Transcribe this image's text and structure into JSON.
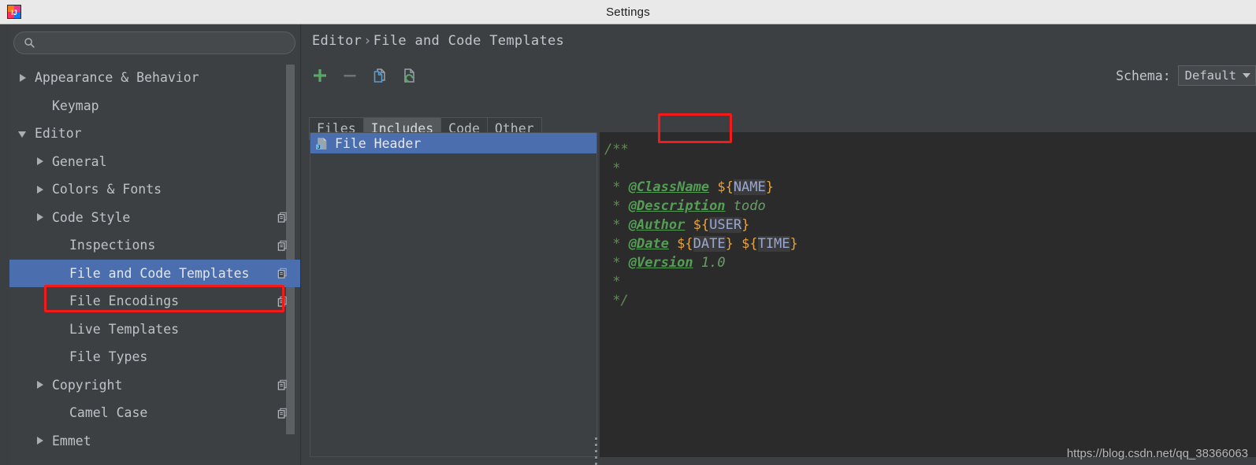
{
  "window": {
    "title": "Settings",
    "app_icon": "intellij-idea-icon"
  },
  "sidebar": {
    "search": {
      "value": "",
      "placeholder": "",
      "icon": "search-icon"
    },
    "items": [
      {
        "label": "Appearance & Behavior",
        "indent": 0,
        "arrow": "closed",
        "selected": false,
        "copy_icon": false
      },
      {
        "label": "Keymap",
        "indent": 1,
        "arrow": "none",
        "selected": false,
        "copy_icon": false
      },
      {
        "label": "Editor",
        "indent": 0,
        "arrow": "open",
        "selected": false,
        "copy_icon": false
      },
      {
        "label": "General",
        "indent": 1,
        "arrow": "closed",
        "selected": false,
        "copy_icon": false
      },
      {
        "label": "Colors & Fonts",
        "indent": 1,
        "arrow": "closed",
        "selected": false,
        "copy_icon": false
      },
      {
        "label": "Code Style",
        "indent": 1,
        "arrow": "closed",
        "selected": false,
        "copy_icon": true
      },
      {
        "label": "Inspections",
        "indent": 2,
        "arrow": "none",
        "selected": false,
        "copy_icon": true
      },
      {
        "label": "File and Code Templates",
        "indent": 2,
        "arrow": "none",
        "selected": true,
        "copy_icon": true
      },
      {
        "label": "File Encodings",
        "indent": 2,
        "arrow": "none",
        "selected": false,
        "copy_icon": true
      },
      {
        "label": "Live Templates",
        "indent": 2,
        "arrow": "none",
        "selected": false,
        "copy_icon": false
      },
      {
        "label": "File Types",
        "indent": 2,
        "arrow": "none",
        "selected": false,
        "copy_icon": false
      },
      {
        "label": "Copyright",
        "indent": 1,
        "arrow": "closed",
        "selected": false,
        "copy_icon": true
      },
      {
        "label": "Camel Case",
        "indent": 2,
        "arrow": "none",
        "selected": false,
        "copy_icon": true
      },
      {
        "label": "Emmet",
        "indent": 1,
        "arrow": "closed",
        "selected": false,
        "copy_icon": false
      }
    ]
  },
  "content": {
    "breadcrumb": {
      "root": "Editor",
      "separator": "›",
      "leaf": "File and Code Templates"
    },
    "toolbar": [
      {
        "name": "add-template-button",
        "icon": "plus-icon"
      },
      {
        "name": "remove-template-button",
        "icon": "minus-icon"
      },
      {
        "name": "copy-template-button",
        "icon": "copy-icon"
      },
      {
        "name": "reset-template-button",
        "icon": "reset-icon"
      }
    ],
    "schema": {
      "label": "Schema:",
      "value": "Default"
    },
    "tabs": [
      {
        "label": "Files",
        "active": false
      },
      {
        "label": "Includes",
        "active": true
      },
      {
        "label": "Code",
        "active": false
      },
      {
        "label": "Other",
        "active": false
      }
    ],
    "template_list": [
      {
        "label": "File Header",
        "selected": true,
        "icon": "java-file-icon"
      }
    ],
    "editor": {
      "lines": [
        [
          {
            "t": "cm",
            "s": "/**"
          }
        ],
        [
          {
            "t": "cm",
            "s": " *"
          }
        ],
        [
          {
            "t": "cm",
            "s": " * "
          },
          {
            "t": "tagname",
            "s": "@ClassName"
          },
          {
            "t": "plain",
            "s": " "
          },
          {
            "t": "var",
            "s": "NAME"
          }
        ],
        [
          {
            "t": "cm",
            "s": " * "
          },
          {
            "t": "tagname",
            "s": "@Description"
          },
          {
            "t": "plain",
            "s": " "
          },
          {
            "t": "tagtext",
            "s": "todo"
          }
        ],
        [
          {
            "t": "cm",
            "s": " * "
          },
          {
            "t": "tagname",
            "s": "@Author"
          },
          {
            "t": "plain",
            "s": " "
          },
          {
            "t": "var",
            "s": "USER"
          }
        ],
        [
          {
            "t": "cm",
            "s": " * "
          },
          {
            "t": "tagname",
            "s": "@Date"
          },
          {
            "t": "plain",
            "s": " "
          },
          {
            "t": "var",
            "s": "DATE"
          },
          {
            "t": "plain",
            "s": " "
          },
          {
            "t": "var",
            "s": "TIME"
          }
        ],
        [
          {
            "t": "cm",
            "s": " * "
          },
          {
            "t": "tagname",
            "s": "@Version"
          },
          {
            "t": "plain",
            "s": " "
          },
          {
            "t": "tagtext",
            "s": "1.0"
          }
        ],
        [
          {
            "t": "cm",
            "s": " *"
          }
        ],
        [
          {
            "t": "cm",
            "s": " */"
          }
        ]
      ]
    },
    "watermark": "https://blog.csdn.net/qq_38366063"
  },
  "annotations": [
    {
      "name": "annotation-box-file-and-code-templates",
      "target": "sidebar-item-file-and-code-templates",
      "color": "#f41a1a"
    },
    {
      "name": "annotation-box-includes-tab",
      "target": "tab-includes",
      "color": "#f41a1a"
    }
  ]
}
